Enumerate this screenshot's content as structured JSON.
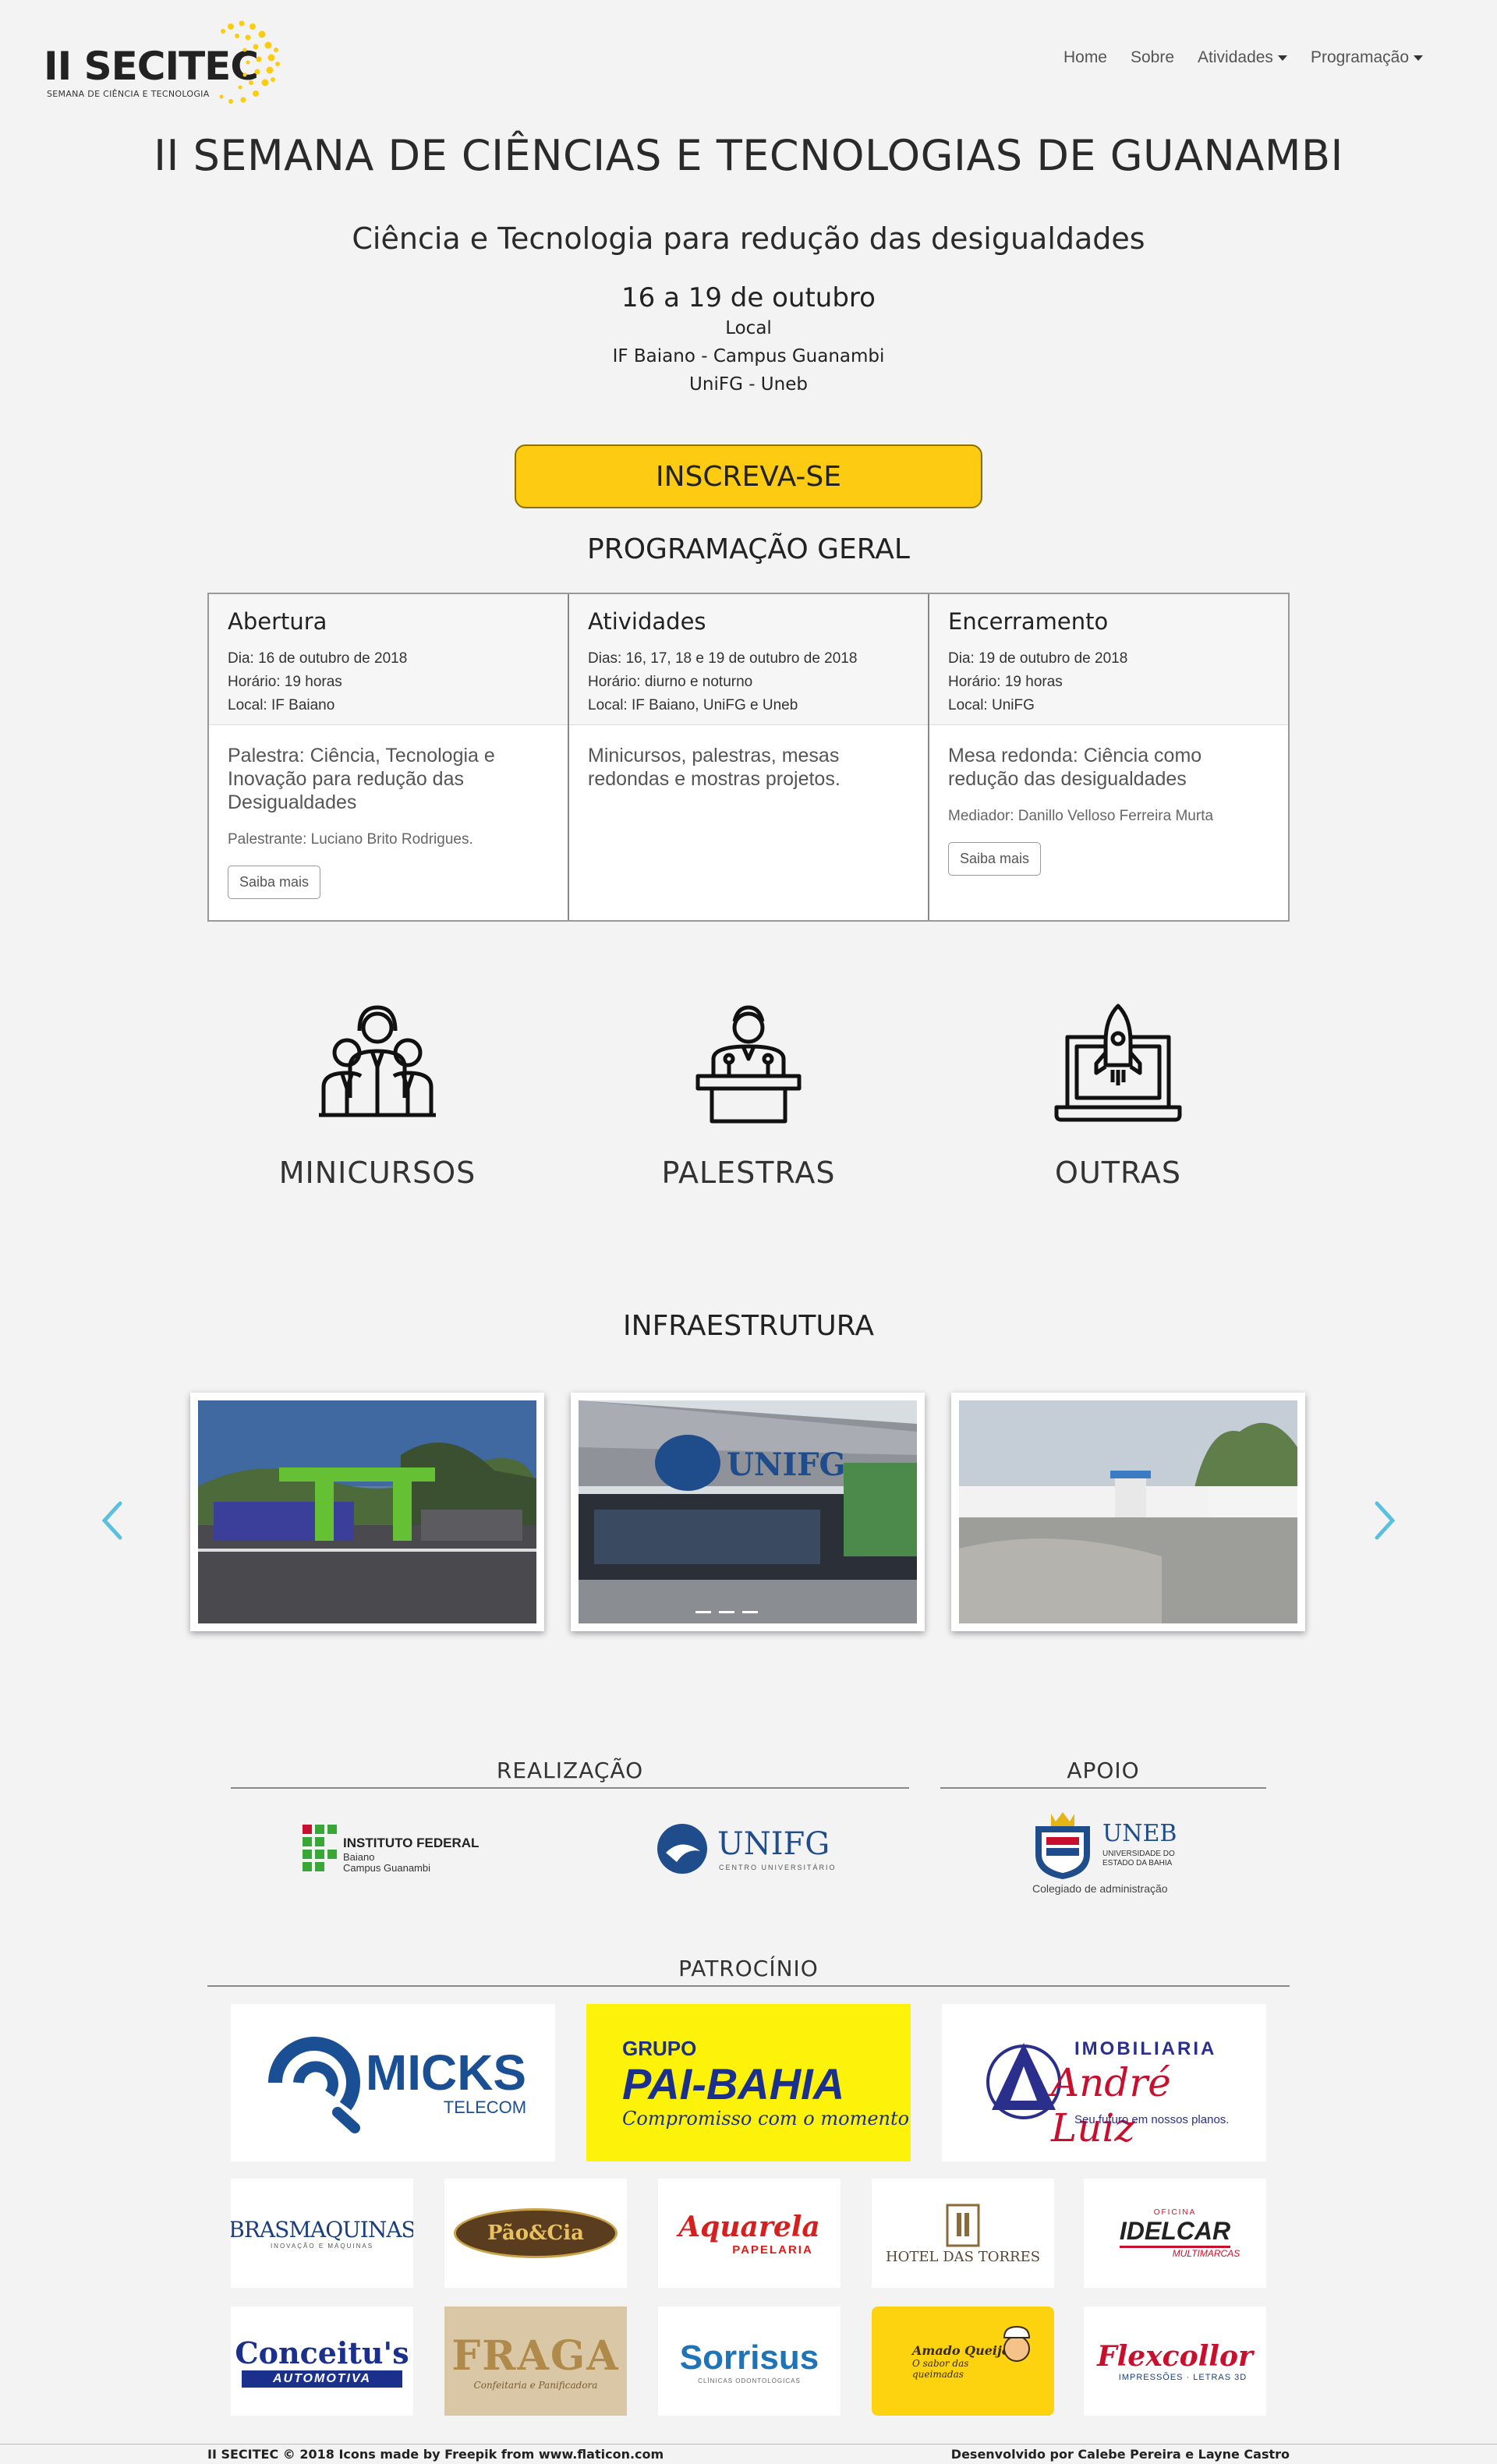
{
  "brand": {
    "name": "II SECITEC",
    "tagline": "SEMANA DE CIÊNCIA E TECNOLOGIA",
    "accent": "#fdcc12"
  },
  "nav": {
    "items": [
      "Home",
      "Sobre",
      "Atividades",
      "Programação"
    ]
  },
  "hero": {
    "title": "II SEMANA DE CIÊNCIAS E TECNOLOGIAS DE GUANAMBI",
    "subtitle": "Ciência e Tecnologia para redução das desigualdades",
    "date": "16 a 19 de outubro",
    "local_label": "Local",
    "local_1": "IF Baiano - Campus Guanambi",
    "local_2": "UniFG - Uneb",
    "cta": "INSCREVA-SE"
  },
  "program": {
    "title": "PROGRAMAÇÃO GERAL",
    "cards": [
      {
        "title": "Abertura",
        "date": "Dia: 16 de outubro de 2018",
        "time": "Horário: 19 horas",
        "place": "Local: IF Baiano",
        "text": "Palestra: Ciência, Tecnologia e Inovação para redução das Desigualdades",
        "small": "Palestrante: Luciano Brito Rodrigues.",
        "button": "Saiba mais"
      },
      {
        "title": "Atividades",
        "date": "Dias: 16, 17, 18 e 19 de outubro de 2018",
        "time": "Horário: diurno e noturno",
        "place": "Local: IF Baiano, UniFG e Uneb",
        "text": "Minicursos, palestras, mesas redondas e mostras projetos.",
        "small": "",
        "button": ""
      },
      {
        "title": "Encerramento",
        "date": "Dia: 19 de outubro de 2018",
        "time": "Horário: 19 horas",
        "place": "Local: UniFG",
        "text": "Mesa redonda: Ciência como redução das desigualdades",
        "small": "Mediador: Danillo Velloso Ferreira Murta",
        "button": "Saiba mais"
      }
    ]
  },
  "features": [
    {
      "label": "MINICURSOS",
      "icon": "group-people-icon"
    },
    {
      "label": "PALESTRAS",
      "icon": "speaker-podium-icon"
    },
    {
      "label": "OUTRAS",
      "icon": "rocket-laptop-icon"
    }
  ],
  "infra": {
    "title": "INFRAESTRUTURA"
  },
  "sponsors": {
    "realizacao": "REALIZAÇÃO",
    "apoio": "APOIO",
    "patrocinio": "PATROCÍNIO",
    "if_name": "INSTITUTO FEDERAL",
    "if_sub1": "Baiano",
    "if_sub2": "Campus Guanambi",
    "unifg": "UNIFG",
    "unifg_sub": "CENTRO UNIVERSITÁRIO",
    "uneb": "UNEB",
    "uneb_sub1": "UNIVERSIDADE DO",
    "uneb_sub2": "ESTADO DA BAHIA",
    "uneb_caption": "Colegiado de administração",
    "micks": "MICKS",
    "micks_sub": "TELECOM",
    "pai_1": "GRUPO",
    "pai_2": "PAI-BAHIA",
    "pai_3": "Compromisso com o momento",
    "andre_1": "IMOBILIARIA",
    "andre_2": "André Luiz",
    "andre_3": "Seu futuro em nossos planos.",
    "bras": "BRASMAQUINAS",
    "bras_sub": "INOVAÇÃO E MÁQUINAS",
    "pao": "Pão&Cia",
    "aquarela": "Aquarela",
    "aquarela_sub": "PAPELARIA",
    "hotel": "HOTEL DAS TORRES",
    "idelcar_1": "OFICINA",
    "idelcar_2": "IDELCAR",
    "idelcar_3": "MULTIMARCAS",
    "conceitus": "Conceitu's",
    "conceitus_sub": "AUTOMOTIVA",
    "fraga": "FRAGA",
    "fraga_sub": "Confeitaria e Panificadora",
    "sorrisus": "Sorrisus",
    "sorrisus_sub": "CLÍNICAS ODONTOLÓGICAS",
    "amado_1": "Amado Queijo",
    "amado_2": "O sabor das",
    "amado_3": "queimadas",
    "flex": "Flexcollor",
    "flex_sub": "IMPRESSÕES · LETRAS 3D"
  },
  "footer": {
    "left": "II SECITEC © 2018 Icons made by Freepik from www.flaticon.com",
    "right": "Desenvolvido por Calebe Pereira e Layne Castro"
  }
}
